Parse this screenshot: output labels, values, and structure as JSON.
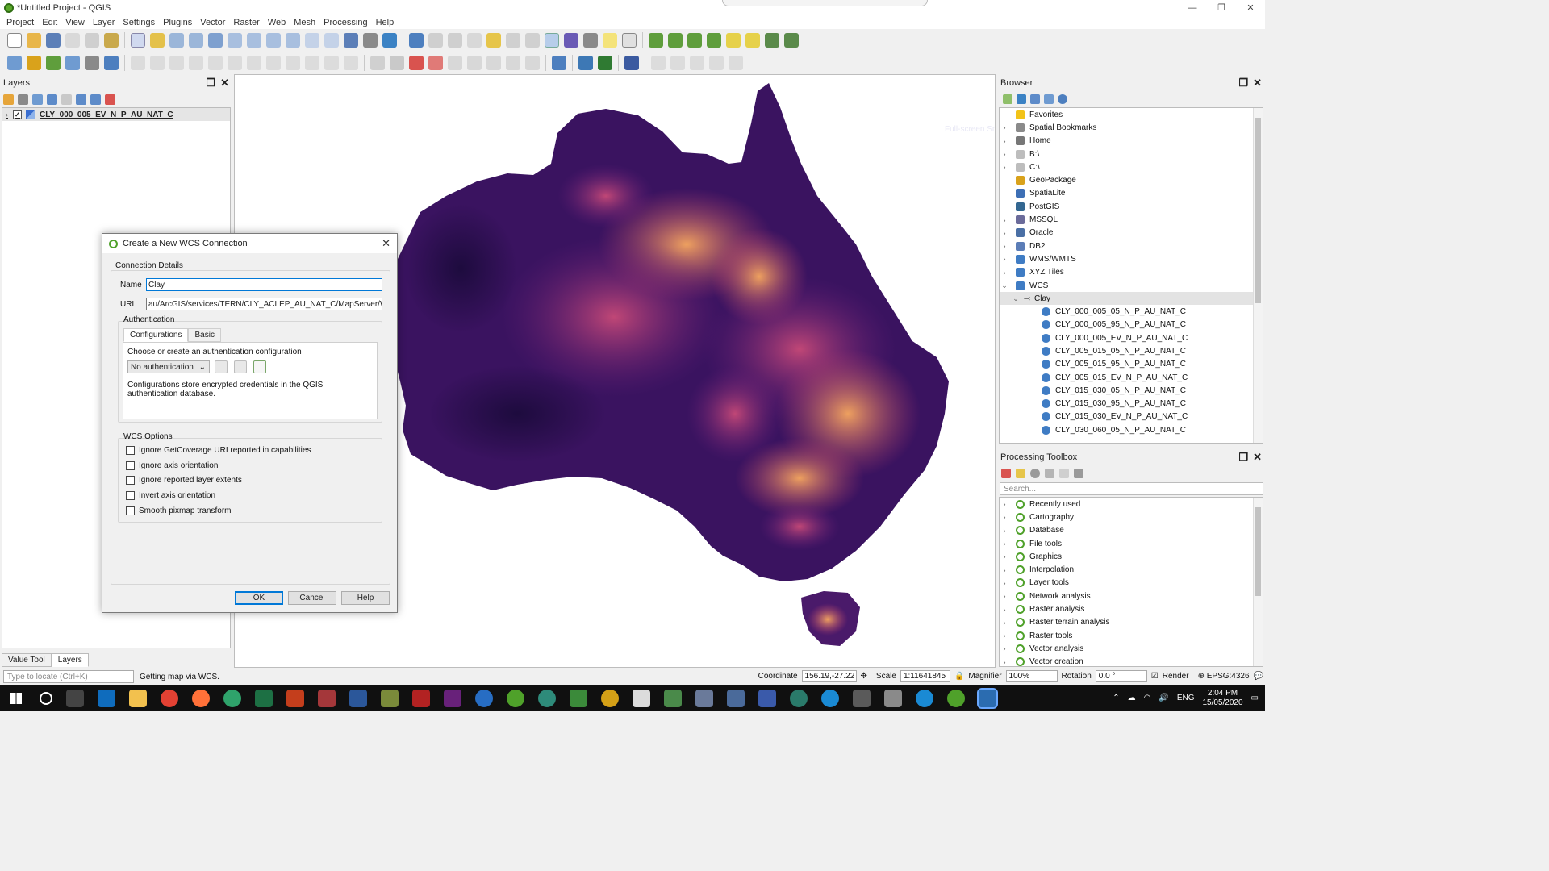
{
  "window": {
    "title": "*Untitled Project - QGIS",
    "minimize": "—",
    "maximize": "❐",
    "close": "✕"
  },
  "menu": [
    "Project",
    "Edit",
    "View",
    "Layer",
    "Settings",
    "Plugins",
    "Vector",
    "Raster",
    "Web",
    "Mesh",
    "Processing",
    "Help"
  ],
  "layers_panel": {
    "title": "Layers",
    "layer": {
      "name": "CLY_000_005_EV_N_P_AU_NAT_C",
      "checked": "✓"
    },
    "bottom_tabs": [
      "Value Tool",
      "Layers"
    ]
  },
  "browser_panel": {
    "title": "Browser",
    "items": [
      {
        "label": "Favorites",
        "arrow": "",
        "color": "#f2c318"
      },
      {
        "label": "Spatial Bookmarks",
        "arrow": "›",
        "color": "#8a8a8a"
      },
      {
        "label": "Home",
        "arrow": "›",
        "color": "#777777"
      },
      {
        "label": "B:\\",
        "arrow": "›",
        "color": "#bdbdbd"
      },
      {
        "label": "C:\\",
        "arrow": "›",
        "color": "#bdbdbd"
      },
      {
        "label": "GeoPackage",
        "arrow": "",
        "color": "#d9a21b"
      },
      {
        "label": "SpatiaLite",
        "arrow": "",
        "color": "#3d6fb5"
      },
      {
        "label": "PostGIS",
        "arrow": "",
        "color": "#336791"
      },
      {
        "label": "MSSQL",
        "arrow": "›",
        "color": "#6b6b9a"
      },
      {
        "label": "Oracle",
        "arrow": "›",
        "color": "#4a6fa5"
      },
      {
        "label": "DB2",
        "arrow": "›",
        "color": "#5b7db7"
      },
      {
        "label": "WMS/WMTS",
        "arrow": "›",
        "color": "#3f7cc4"
      },
      {
        "label": "XYZ Tiles",
        "arrow": "›",
        "color": "#3f7cc4"
      },
      {
        "label": "WCS",
        "arrow": "⌄",
        "color": "#3f7cc4"
      }
    ],
    "connection": {
      "label": "Clay",
      "arrow": "⌄"
    },
    "coverages": [
      "CLY_000_005_05_N_P_AU_NAT_C",
      "CLY_000_005_95_N_P_AU_NAT_C",
      "CLY_000_005_EV_N_P_AU_NAT_C",
      "CLY_005_015_05_N_P_AU_NAT_C",
      "CLY_005_015_95_N_P_AU_NAT_C",
      "CLY_005_015_EV_N_P_AU_NAT_C",
      "CLY_015_030_05_N_P_AU_NAT_C",
      "CLY_015_030_95_N_P_AU_NAT_C",
      "CLY_015_030_EV_N_P_AU_NAT_C",
      "CLY_030_060_05_N_P_AU_NAT_C"
    ]
  },
  "processing_panel": {
    "title": "Processing Toolbox",
    "search_placeholder": "Search...",
    "items": [
      "Recently used",
      "Cartography",
      "Database",
      "File tools",
      "Graphics",
      "Interpolation",
      "Layer tools",
      "Network analysis",
      "Raster analysis",
      "Raster terrain analysis",
      "Raster tools",
      "Vector analysis",
      "Vector creation"
    ]
  },
  "map": {
    "ghost_text": "Full-screen Sn"
  },
  "dialog": {
    "title": "Create a New WCS Connection",
    "group_connection": "Connection Details",
    "name_label": "Name",
    "name_value": "Clay",
    "url_label": "URL",
    "url_value": "au/ArcGIS/services/TERN/CLY_ACLEP_AU_NAT_C/MapServer/WCSServer",
    "auth_group": "Authentication",
    "auth_tabs": [
      "Configurations",
      "Basic"
    ],
    "auth_hint": "Choose or create an authentication configuration",
    "auth_select": "No authentication",
    "auth_note": "Configurations store encrypted credentials in the QGIS authentication database.",
    "options_group": "WCS Options",
    "options": [
      "Ignore GetCoverage URI reported in capabilities",
      "Ignore axis orientation",
      "Ignore reported layer extents",
      "Invert axis orientation",
      "Smooth pixmap transform"
    ],
    "ok": "OK",
    "cancel": "Cancel",
    "help": "Help"
  },
  "statusbar": {
    "locate_placeholder": "Type to locate (Ctrl+K)",
    "message": "Getting map via WCS.",
    "coordinate_label": "Coordinate",
    "coordinate_value": "156.19,-27.22",
    "scale_label": "Scale",
    "scale_value": "1:11641845",
    "magnifier_label": "Magnifier",
    "magnifier_value": "100%",
    "rotation_label": "Rotation",
    "rotation_value": "0.0 °",
    "render_label": "Render",
    "crs": "EPSG:4326"
  },
  "taskbar": {
    "language": "ENG",
    "time": "2:04 PM",
    "date": "15/05/2020"
  },
  "colors": {
    "map_dark": "#2c0f4f",
    "map_mid": "#6d1f7a",
    "map_light": "#f4a064",
    "qgis_green": "#4fa12a",
    "accent": "#0078d7"
  }
}
